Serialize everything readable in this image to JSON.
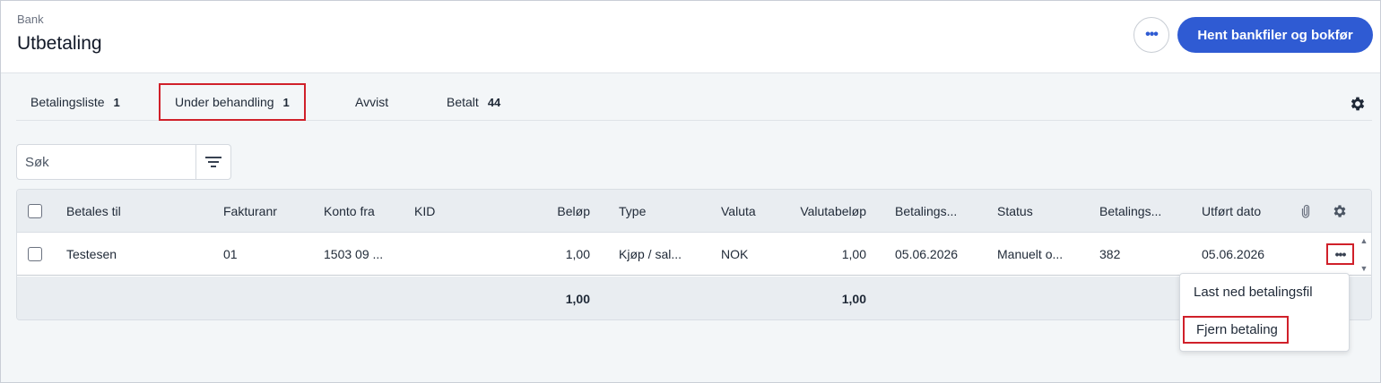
{
  "header": {
    "breadcrumb": "Bank",
    "title": "Utbetaling",
    "more_label": "•••",
    "primary_label": "Hent bankfiler og bokfør"
  },
  "tabs": [
    {
      "label": "Betalingsliste",
      "count": "1",
      "active": false
    },
    {
      "label": "Under behandling",
      "count": "1",
      "active": true
    },
    {
      "label": "Avvist",
      "count": "",
      "active": false
    },
    {
      "label": "Betalt",
      "count": "44",
      "active": false
    }
  ],
  "search": {
    "placeholder": "Søk"
  },
  "table": {
    "columns": [
      "Betales til",
      "Fakturanr",
      "Konto fra",
      "KID",
      "Beløp",
      "Type",
      "Valuta",
      "Valutabeløp",
      "Betalings...",
      "Status",
      "Betalings...",
      "Utført dato"
    ],
    "rows": [
      {
        "betales_til": "Testesen",
        "fakturanr": "01",
        "konto_fra": "1503 09 ...",
        "kid": "",
        "belop": "1,00",
        "type": "Kjøp / sal...",
        "valuta": "NOK",
        "valutabelop": "1,00",
        "betalingsdato": "05.06.2026",
        "status": "Manuelt o...",
        "betalingsid": "382",
        "utfort_dato": "05.06.2026"
      }
    ],
    "totals": {
      "belop": "1,00",
      "valutabelop": "1,00"
    },
    "row_menu_label": "•••"
  },
  "row_menu": {
    "items": [
      "Last ned betalingsfil",
      "Fjern betaling"
    ]
  },
  "colors": {
    "primary": "#2f5bd3",
    "highlight": "#d0202a",
    "header_bg": "#e9edf1"
  }
}
